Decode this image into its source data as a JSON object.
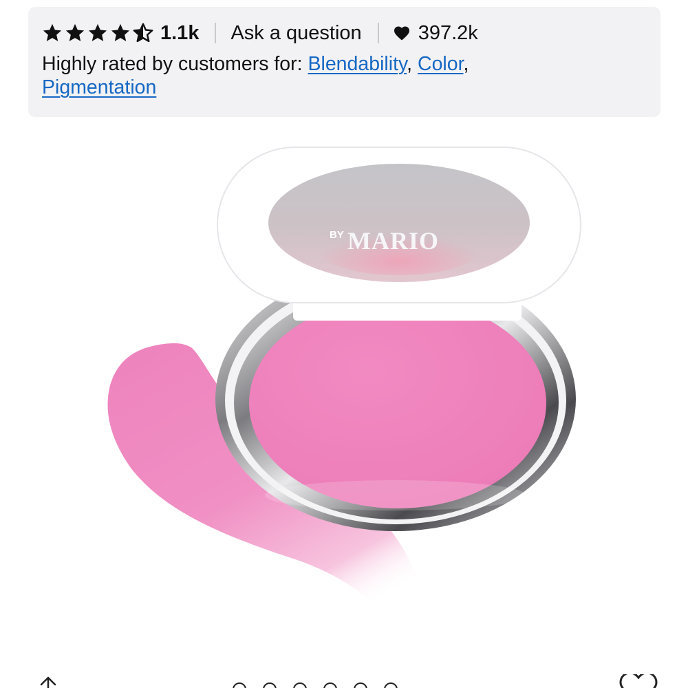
{
  "rating": {
    "stars_value": 4.5,
    "review_count": "1.1k",
    "ask_label": "Ask a question",
    "loves_count": "397.2k",
    "icons": {
      "star": "star-icon",
      "half_star": "star-half-icon",
      "heart": "heart-icon"
    }
  },
  "rated_for": {
    "prefix": "Highly rated by customers for: ",
    "links": [
      "Blendability",
      "Color",
      "Pigmentation"
    ]
  },
  "product_image": {
    "brand_text": "MARIO",
    "brand_superscript": "BY",
    "colors": {
      "pink": "#f086bf",
      "lid": "#ffffff",
      "window": "#c8c8cc"
    }
  },
  "bottom_bar": {
    "icons": {
      "share": "share-icon",
      "favorite": "heart-outline-icon"
    },
    "carousel_dot_count": 6
  },
  "colors": {
    "card_bg": "#f2f2f4",
    "link": "#1668c4",
    "text": "#111111"
  }
}
